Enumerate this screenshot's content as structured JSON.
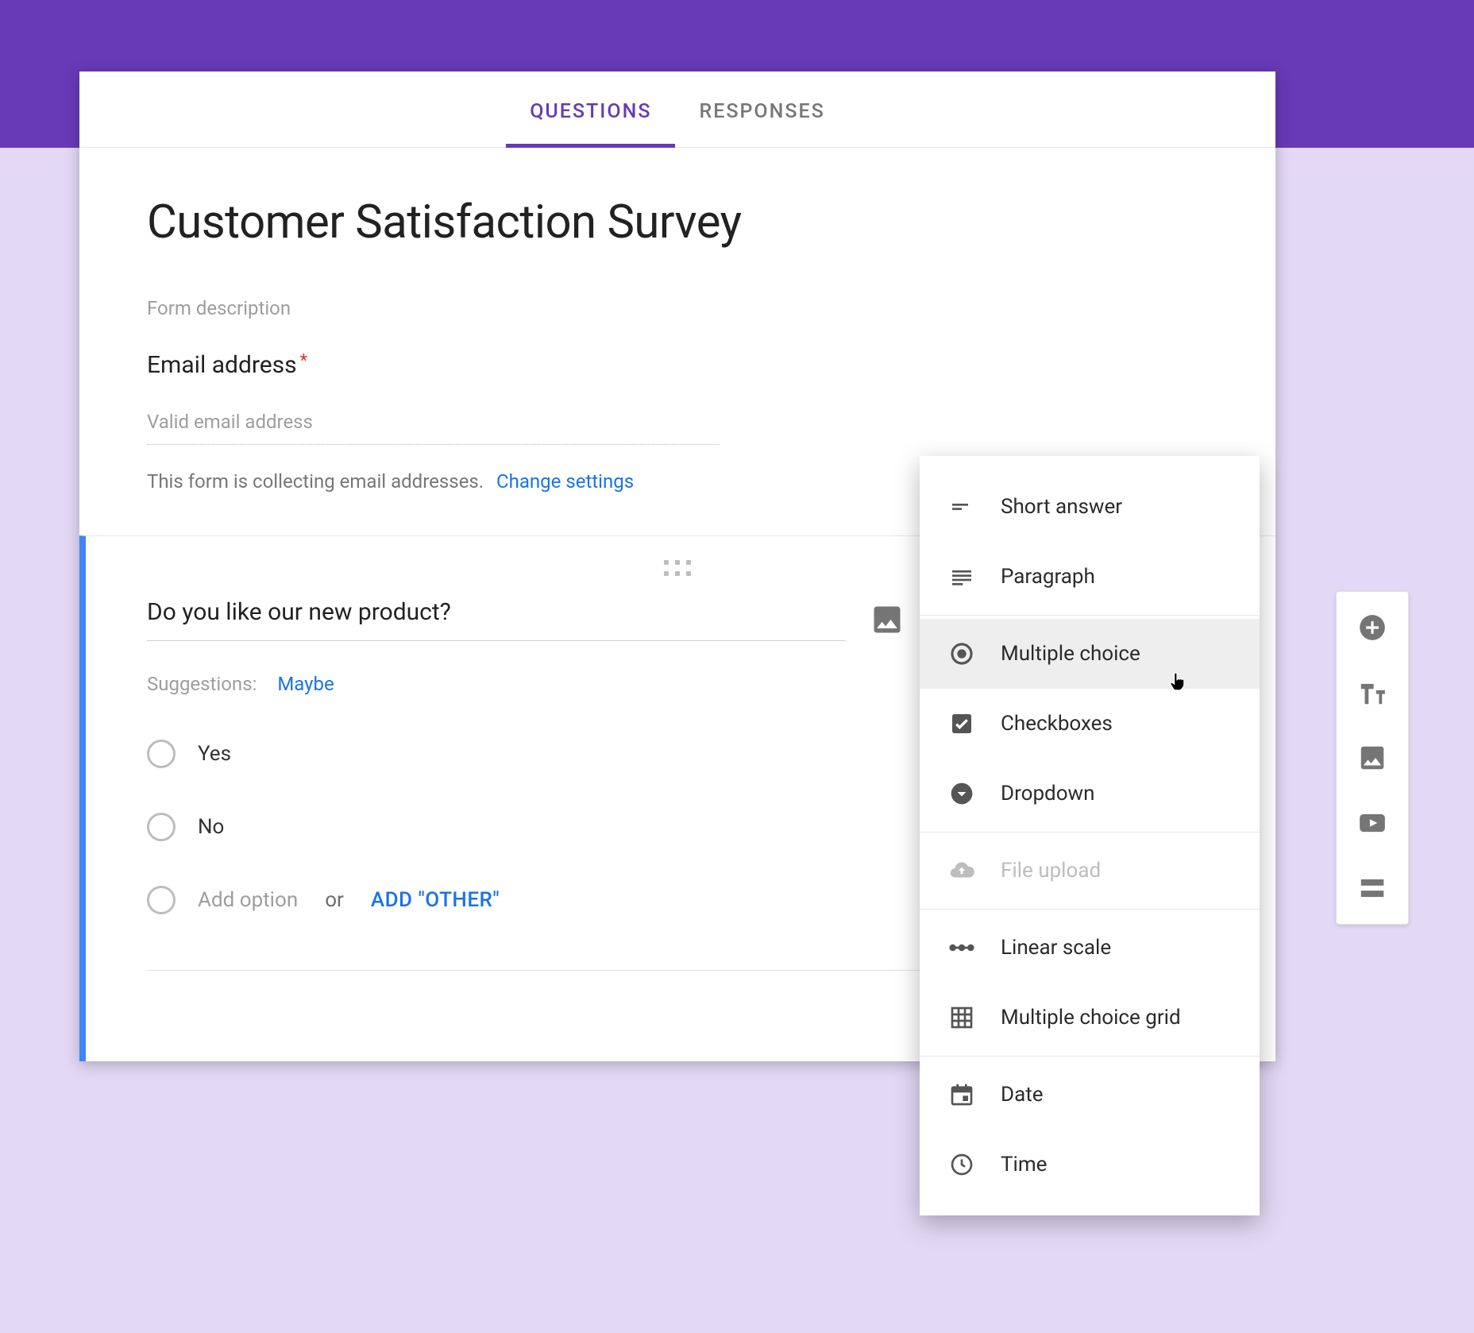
{
  "tabs": {
    "questions": "QUESTIONS",
    "responses": "RESPONSES",
    "active": "questions"
  },
  "form": {
    "title": "Customer Satisfaction Survey",
    "description_placeholder": "Form description"
  },
  "email": {
    "label": "Email address",
    "required_marker": "*",
    "placeholder": "Valid email address",
    "collecting_text": "This form is collecting email addresses.",
    "change_settings": "Change settings"
  },
  "question": {
    "title": "Do you like our new product?",
    "suggestions_label": "Suggestions:",
    "suggestions": [
      "Maybe"
    ],
    "options": [
      "Yes",
      "No"
    ],
    "add_option_placeholder": "Add option",
    "or_text": "or",
    "add_other": "ADD \"OTHER\""
  },
  "type_menu": {
    "selected": "multiple_choice",
    "items": [
      {
        "id": "short_answer",
        "label": "Short answer"
      },
      {
        "id": "paragraph",
        "label": "Paragraph"
      },
      {
        "sep": true
      },
      {
        "id": "multiple_choice",
        "label": "Multiple choice"
      },
      {
        "id": "checkboxes",
        "label": "Checkboxes"
      },
      {
        "id": "dropdown",
        "label": "Dropdown"
      },
      {
        "sep": true
      },
      {
        "id": "file_upload",
        "label": "File upload",
        "disabled": true
      },
      {
        "sep": true
      },
      {
        "id": "linear_scale",
        "label": "Linear scale"
      },
      {
        "id": "grid",
        "label": "Multiple choice grid"
      },
      {
        "sep": true
      },
      {
        "id": "date",
        "label": "Date"
      },
      {
        "id": "time",
        "label": "Time"
      }
    ]
  },
  "side_toolbar": {
    "add_question": "Add question",
    "add_title": "Add title and description",
    "add_image": "Add image",
    "add_video": "Add video",
    "add_section": "Add section"
  }
}
